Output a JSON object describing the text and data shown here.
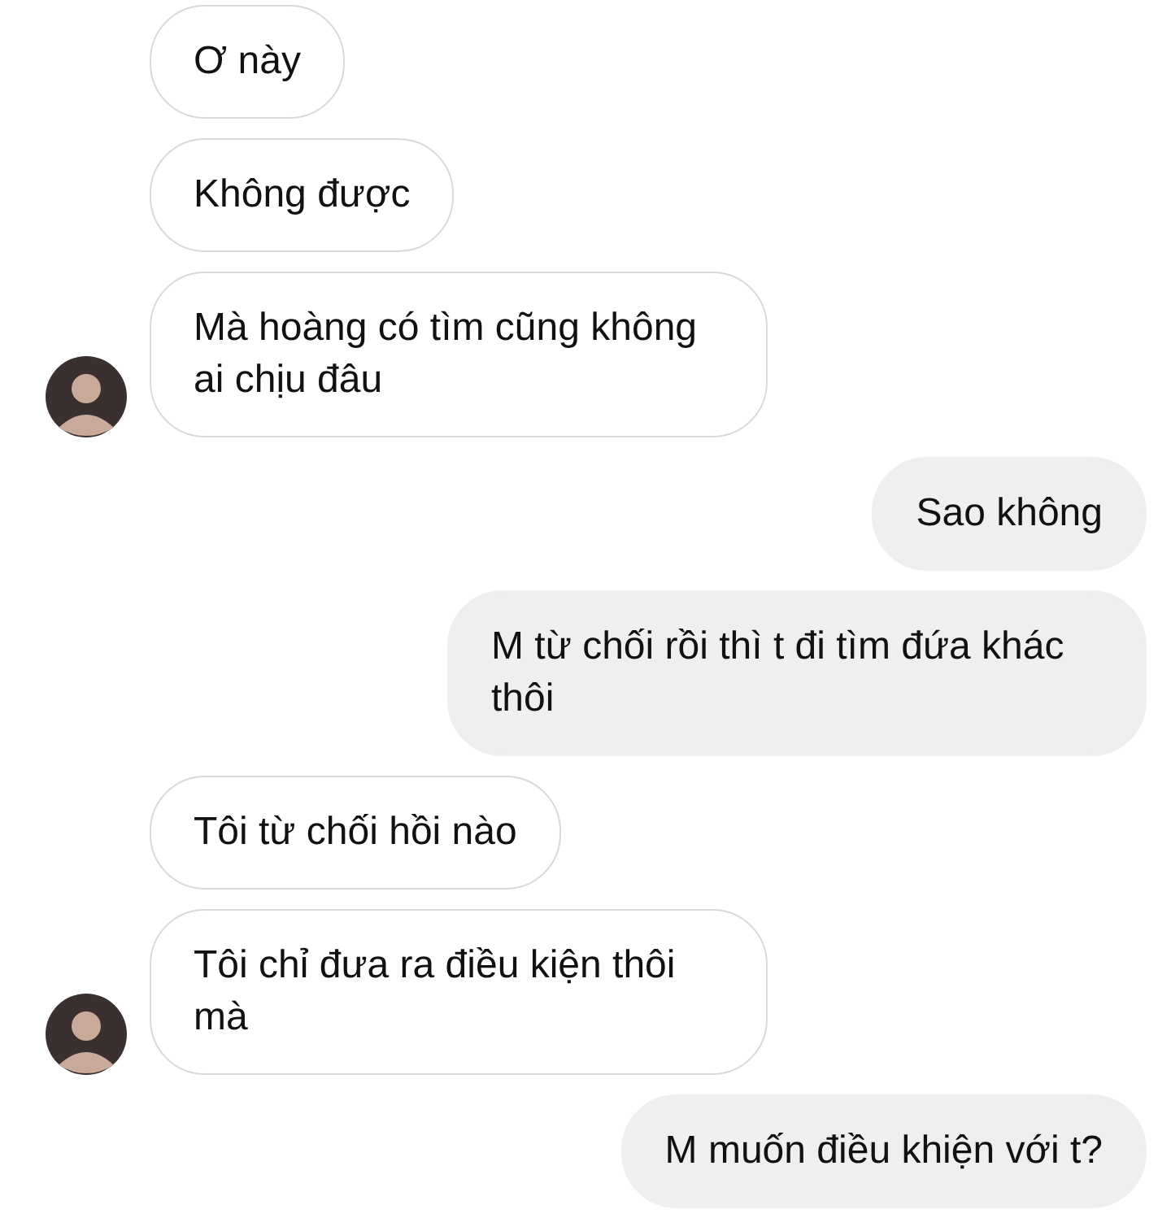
{
  "messages": [
    {
      "kind": "incoming",
      "text": "Ơ này",
      "avatar": false
    },
    {
      "kind": "incoming",
      "text": "Không được",
      "avatar": false
    },
    {
      "kind": "incoming",
      "text": "Mà hoàng có tìm cũng không ai chịu đâu",
      "avatar": true
    },
    {
      "kind": "outgoing",
      "text": "Sao không"
    },
    {
      "kind": "outgoing",
      "text": "M từ chối rồi thì t đi tìm đứa khác thôi"
    },
    {
      "kind": "incoming",
      "text": "Tôi từ chối hồi nào",
      "avatar": false
    },
    {
      "kind": "incoming",
      "text": "Tôi chỉ đưa ra điều kiện thôi mà",
      "avatar": true
    },
    {
      "kind": "outgoing",
      "text": "M muốn điều khiện với t?"
    }
  ]
}
